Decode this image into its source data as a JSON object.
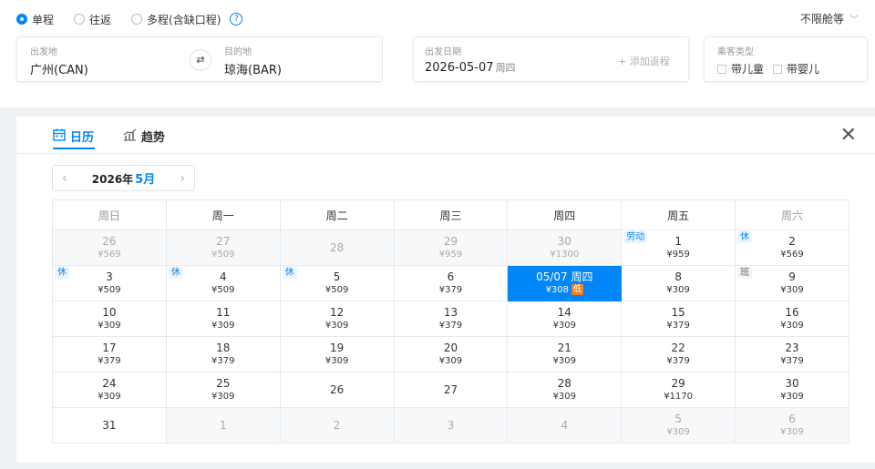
{
  "trip_types": [
    {
      "label": "单程",
      "checked": true
    },
    {
      "label": "往返",
      "checked": false
    },
    {
      "label": "多程(含缺口程)",
      "checked": false
    }
  ],
  "help_icon": "?",
  "cabin": {
    "label": "不限舱等",
    "icon": "chevron-down-icon"
  },
  "from": {
    "label": "出发地",
    "value": "广州(CAN)"
  },
  "swap_icon": "⇄",
  "to": {
    "label": "目的地",
    "value": "琼海(BAR)"
  },
  "depart": {
    "label": "出发日期",
    "date": "2026-05-07",
    "weekday": "周四",
    "add_return": "+ 添加返程"
  },
  "passengers": {
    "label": "乘客类型",
    "options": [
      "带儿童",
      "带婴儿"
    ]
  },
  "tabs": [
    {
      "label": "日历",
      "icon": "calendar-icon",
      "active": true
    },
    {
      "label": "趋势",
      "icon": "trend-chart-icon",
      "active": false
    }
  ],
  "close_icon": "✕",
  "month_nav": {
    "year": "2026年",
    "month": "5月",
    "prev": "‹",
    "next": "›"
  },
  "weekdays": [
    "周日",
    "周一",
    "周二",
    "周三",
    "周四",
    "周五",
    "周六"
  ],
  "weeks": [
    [
      {
        "day": "26",
        "price": "¥569",
        "past": true
      },
      {
        "day": "27",
        "price": "¥509",
        "past": true
      },
      {
        "day": "28",
        "price": "",
        "past": true
      },
      {
        "day": "29",
        "price": "¥959",
        "past": true
      },
      {
        "day": "30",
        "price": "¥1300",
        "past": true
      },
      {
        "day": "1",
        "price": "¥959",
        "tag": "劳动"
      },
      {
        "day": "2",
        "price": "¥569",
        "tag": "休"
      }
    ],
    [
      {
        "day": "3",
        "price": "¥509",
        "tag": "休"
      },
      {
        "day": "4",
        "price": "¥509",
        "tag": "休"
      },
      {
        "day": "5",
        "price": "¥509",
        "tag": "休"
      },
      {
        "day": "6",
        "price": "¥379"
      },
      {
        "day": "05/07 周四",
        "price": "¥308",
        "selected": true,
        "low": "低"
      },
      {
        "day": "8",
        "price": "¥309"
      },
      {
        "day": "9",
        "price": "¥309",
        "tag": "班",
        "tag_type": "work"
      }
    ],
    [
      {
        "day": "10",
        "price": "¥309"
      },
      {
        "day": "11",
        "price": "¥309"
      },
      {
        "day": "12",
        "price": "¥309"
      },
      {
        "day": "13",
        "price": "¥379"
      },
      {
        "day": "14",
        "price": "¥309"
      },
      {
        "day": "15",
        "price": "¥379"
      },
      {
        "day": "16",
        "price": "¥309"
      }
    ],
    [
      {
        "day": "17",
        "price": "¥379"
      },
      {
        "day": "18",
        "price": "¥379"
      },
      {
        "day": "19",
        "price": "¥309"
      },
      {
        "day": "20",
        "price": "¥309"
      },
      {
        "day": "21",
        "price": "¥309"
      },
      {
        "day": "22",
        "price": "¥379"
      },
      {
        "day": "23",
        "price": "¥379"
      }
    ],
    [
      {
        "day": "24",
        "price": "¥309"
      },
      {
        "day": "25",
        "price": "¥309"
      },
      {
        "day": "26",
        "price": ""
      },
      {
        "day": "27",
        "price": ""
      },
      {
        "day": "28",
        "price": "¥309"
      },
      {
        "day": "29",
        "price": "¥1170"
      },
      {
        "day": "30",
        "price": "¥309"
      }
    ],
    [
      {
        "day": "31",
        "price": ""
      },
      {
        "day": "1",
        "price": "",
        "past": true
      },
      {
        "day": "2",
        "price": "",
        "past": true
      },
      {
        "day": "3",
        "price": "",
        "past": true
      },
      {
        "day": "4",
        "price": "",
        "past": true
      },
      {
        "day": "5",
        "price": "¥309",
        "past": true
      },
      {
        "day": "6",
        "price": "¥309",
        "past": true
      }
    ]
  ],
  "colors": {
    "accent": "#0086f6",
    "low_badge": "#ff7d13"
  }
}
